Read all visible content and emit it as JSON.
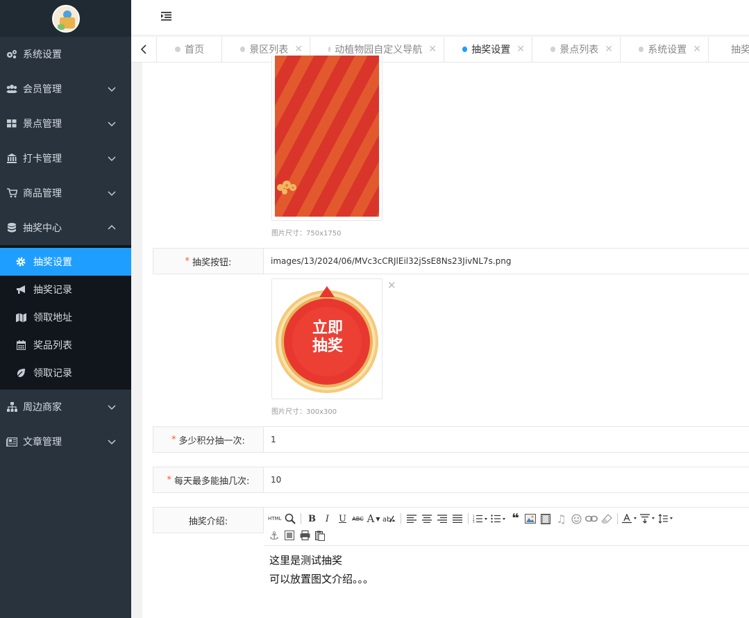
{
  "sidebar": {
    "items": [
      {
        "label": "系统设置",
        "icon": "gears-icon"
      },
      {
        "label": "会员管理",
        "icon": "users-icon"
      },
      {
        "label": "景点管理",
        "icon": "grid-icon"
      },
      {
        "label": "打卡管理",
        "icon": "bank-icon"
      },
      {
        "label": "商品管理",
        "icon": "cart-icon"
      },
      {
        "label": "抽奖中心",
        "icon": "database-icon"
      },
      {
        "label": "周边商家",
        "icon": "sitemap-icon"
      },
      {
        "label": "文章管理",
        "icon": "newspaper-icon"
      }
    ],
    "submenu": [
      {
        "label": "抽奖设置",
        "icon": "gear-icon"
      },
      {
        "label": "抽奖记录",
        "icon": "bullhorn-icon"
      },
      {
        "label": "领取地址",
        "icon": "map-icon"
      },
      {
        "label": "奖品列表",
        "icon": "calendar-icon"
      },
      {
        "label": "领取记录",
        "icon": "leaf-icon"
      }
    ]
  },
  "tabs": [
    {
      "label": "首页",
      "closable": false
    },
    {
      "label": "景区列表",
      "closable": true
    },
    {
      "label": "动植物园自定义导航",
      "closable": true
    },
    {
      "label": "抽奖设置",
      "closable": true,
      "active": true
    },
    {
      "label": "景点列表",
      "closable": true
    },
    {
      "label": "系统设置",
      "closable": true
    },
    {
      "label": "抽奖",
      "closable": false
    }
  ],
  "form": {
    "bg_image_hint": "图片尺寸：750x1750",
    "button_label": "抽奖按钮:",
    "button_value": "images/13/2024/06/MVc3cCRJlEil32jSsE8Ns23JivNL7s.png",
    "button_image_text_line1": "立即",
    "button_image_text_line2": "抽奖",
    "button_hint": "图片尺寸：300x300",
    "points_label": "多少积分抽一次:",
    "points_value": "1",
    "daily_label": "每天最多能抽几次:",
    "daily_value": "10",
    "intro_label": "抽奖介绍:"
  },
  "editor": {
    "html_btn": "HTML",
    "bold": "B",
    "italic": "I",
    "underline": "U",
    "strike": "ABC",
    "fontcolor": "A",
    "line1": "这里是测试抽奖",
    "line2": "可以放置图文介绍。。。"
  },
  "colors": {
    "sidebar_bg": "#28333e",
    "active": "#1e9fff",
    "required": "#ff5722"
  }
}
